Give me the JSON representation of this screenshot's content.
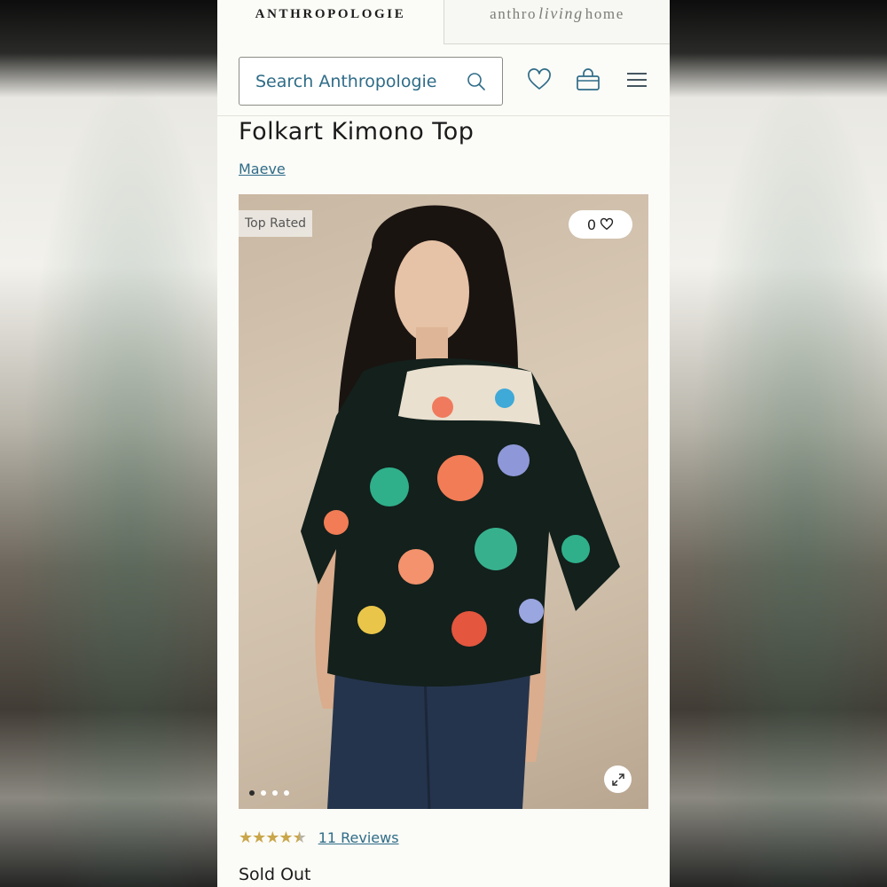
{
  "brand_tabs": {
    "anthropologie": "ANTHROPOLOGIE",
    "home_prefix": "anthro",
    "home_script": "living",
    "home_suffix": "home"
  },
  "search": {
    "placeholder": "Search Anthropologie"
  },
  "header_icons": [
    "heart-icon",
    "bag-icon",
    "menu-icon"
  ],
  "product": {
    "title": "Folkart Kimono Top",
    "brand": "Maeve",
    "badge": "Top Rated",
    "wishlist_count": "0",
    "image_count": 4,
    "active_image": 1,
    "rating": 4.5,
    "rating_max": 5,
    "reviews_label": "11 Reviews",
    "status": "Sold Out"
  },
  "colors": {
    "link": "#2f6c88",
    "star": "#c9a64a",
    "page_bg": "#fbfbf7"
  }
}
